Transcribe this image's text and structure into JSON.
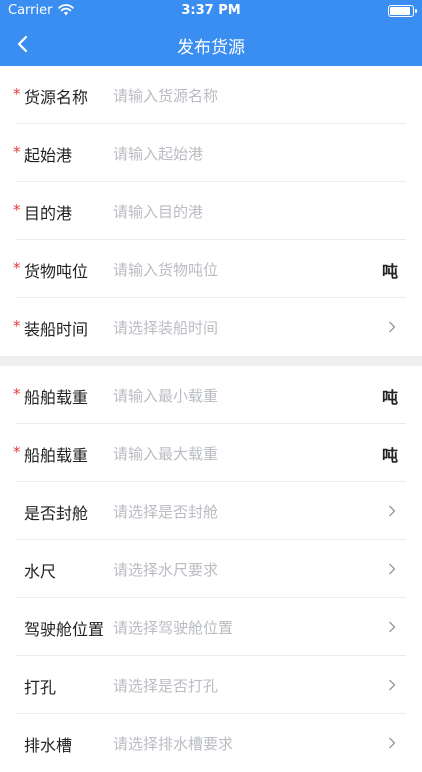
{
  "status_bar": {
    "carrier": "Carrier",
    "time": "3:37 PM"
  },
  "navbar": {
    "title": "发布货源"
  },
  "section1": [
    {
      "label": "货源名称",
      "placeholder": "请输入货源名称",
      "required": "*"
    },
    {
      "label": "起始港",
      "placeholder": "请输入起始港",
      "required": "*"
    },
    {
      "label": "目的港",
      "placeholder": "请输入目的港",
      "required": "*"
    },
    {
      "label": "货物吨位",
      "placeholder": "请输入货物吨位",
      "required": "*",
      "unit": "吨"
    },
    {
      "label": "装船时间",
      "placeholder": "请选择装船时间",
      "required": "*"
    }
  ],
  "section2": [
    {
      "label": "船舶载重",
      "placeholder": "请输入最小载重",
      "required": "*",
      "unit": "吨"
    },
    {
      "label": "船舶载重",
      "placeholder": "请输入最大载重",
      "required": "*",
      "unit": "吨"
    },
    {
      "label": "是否封舱",
      "placeholder": "请选择是否封舱"
    },
    {
      "label": "水尺",
      "placeholder": "请选择水尺要求"
    },
    {
      "label": "驾驶舱位置",
      "placeholder": "请选择驾驶舱位置"
    },
    {
      "label": "打孔",
      "placeholder": "请选择是否打孔"
    },
    {
      "label": "排水槽",
      "placeholder": "请选择排水槽要求"
    }
  ]
}
